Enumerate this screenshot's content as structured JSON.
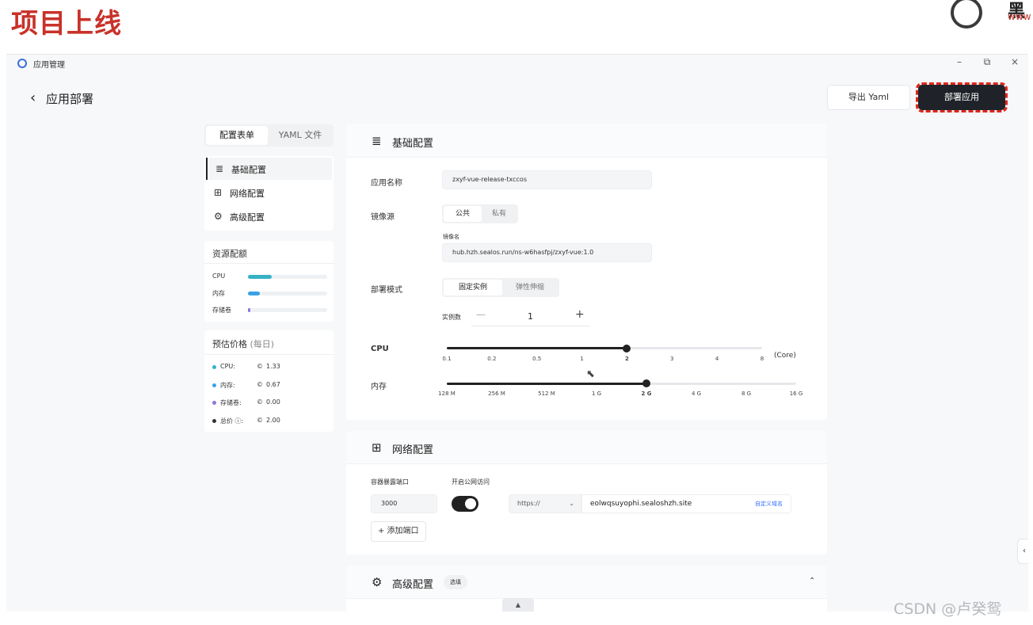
{
  "slide": {
    "title": "项目上线",
    "brand": "黑",
    "brand_url": "www"
  },
  "window": {
    "title": "应用管理",
    "controls": {
      "minimize": "–",
      "restore": "⧉",
      "close": "×"
    }
  },
  "header": {
    "back": "‹",
    "title": "应用部署",
    "export_label": "导出 Yaml",
    "deploy_label": "部署应用"
  },
  "tabs": {
    "form": "配置表单",
    "yaml": "YAML 文件"
  },
  "nav": [
    {
      "icon": "≣",
      "label": "基础配置"
    },
    {
      "icon": "⊞",
      "label": "网络配置"
    },
    {
      "icon": "⚙",
      "label": "高级配置"
    }
  ],
  "resources": {
    "title": "资源配额",
    "items": [
      {
        "label": "CPU",
        "fraction": 0.3,
        "color": "#36b2c4"
      },
      {
        "label": "内存",
        "fraction": 0.15,
        "color": "#3aa1e6"
      },
      {
        "label": "存储卷",
        "fraction": 0.03,
        "color": "#8f75d6"
      }
    ]
  },
  "price": {
    "title": "预估价格",
    "subtitle": "(每日)",
    "items": [
      {
        "label": "CPU:",
        "value": "1.33",
        "color": "#36b2c4"
      },
      {
        "label": "内存:",
        "value": "0.67",
        "color": "#3aa1e6"
      },
      {
        "label": "存储卷:",
        "value": "0.00",
        "color": "#8f75d6"
      },
      {
        "label": "总价 ⓘ:",
        "value": "2.00",
        "color": "#333333"
      }
    ],
    "coin": "©"
  },
  "basic": {
    "title": "基础配置",
    "app_name_label": "应用名称",
    "app_name_value": "zxyf-vue-release-txccos",
    "image_source_label": "镜像源",
    "image_source_options": [
      "公共",
      "私有"
    ],
    "image_name_label": "镜像名",
    "image_name_value": "hub.hzh.sealos.run/ns-w6hasfpj/zxyf-vue:1.0",
    "deploy_mode_label": "部署模式",
    "deploy_mode_options": [
      "固定实例",
      "弹性伸缩"
    ],
    "replicas_label": "实例数",
    "replicas_value": "1",
    "replicas_minus": "—",
    "replicas_plus": "+",
    "cpu_label": "CPU",
    "cpu_ticks": [
      "0.1",
      "0.2",
      "0.5",
      "1",
      "2",
      "3",
      "4",
      "8"
    ],
    "cpu_unit": "(Core)",
    "cpu_selected_index": 4,
    "memory_label": "内存",
    "memory_ticks": [
      "128 M",
      "256 M",
      "512 M",
      "1 G",
      "2 G",
      "4 G",
      "8 G",
      "16 G"
    ],
    "memory_selected_index": 4
  },
  "network": {
    "title": "网络配置",
    "port_label": "容器暴露端口",
    "port_value": "3000",
    "public_label": "开启公网访问",
    "public_enabled": true,
    "protocol": "https://",
    "protocol_chevron": "⌄",
    "domain": "eolwqsuyophi.sealoshzh.site",
    "custom_domain": "自定义域名",
    "add_port": "+ 添加端口"
  },
  "advanced": {
    "title": "高级配置",
    "badge": "选填",
    "caret": "⌃"
  },
  "misc": {
    "scroll_up": "▲",
    "side_tab": "‹",
    "watermark": "CSDN @卢癸鸳"
  }
}
